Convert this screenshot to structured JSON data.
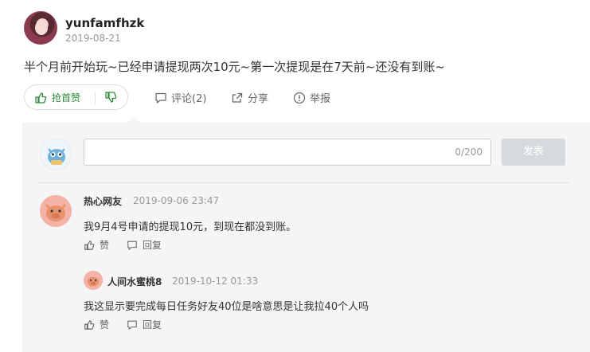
{
  "post": {
    "username": "yunfamfhzk",
    "date": "2019-08-21",
    "body": "半个月前开始玩~已经申请提现两次10元~第一次提现是在7天前~还没有到账~"
  },
  "actions": {
    "upvote_label": "抢首赞",
    "comment_label": "评论(2)",
    "share_label": "分享",
    "report_label": "举报"
  },
  "editor": {
    "placeholder": "",
    "counter": "0/200",
    "submit_label": "发表"
  },
  "comments": [
    {
      "author": "热心网友",
      "time": "2019-09-06 23:47",
      "text": "我9月4号申请的提现10元，到现在都没到账。",
      "like_label": "赞",
      "reply_label": "回复"
    }
  ],
  "replies": [
    {
      "author": "人间水蜜桃8",
      "time": "2019-10-12 01:33",
      "text": "我这显示要完成每日任务好友40位是啥意思是让我拉40个人吗",
      "like_label": "赞",
      "reply_label": "回复"
    }
  ],
  "colors": {
    "upvote_green": "#2e8b3a",
    "panel_bg": "#f5f5f5",
    "submit_bg": "#d6dadd"
  }
}
